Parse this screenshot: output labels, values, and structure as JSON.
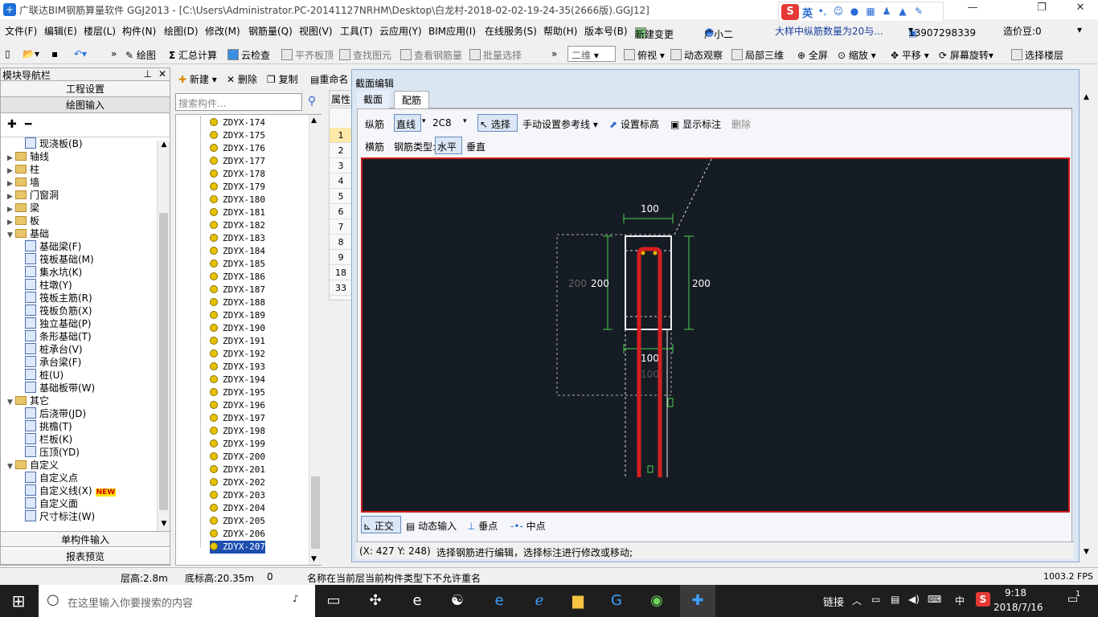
{
  "window": {
    "title": "广联达BIM钢筋算量软件 GGJ2013 - [C:\\Users\\Administrator.PC-20141127NRHM\\Desktop\\白龙村-2018-02-02-19-24-35(2666版).GGJ12]"
  },
  "ime": {
    "label": "英"
  },
  "menu": [
    "文件(F)",
    "编辑(E)",
    "楼层(L)",
    "构件(N)",
    "绘图(D)",
    "修改(M)",
    "钢筋量(Q)",
    "视图(V)",
    "工具(T)",
    "云应用(Y)",
    "BIM应用(I)",
    "在线服务(S)",
    "帮助(H)",
    "版本号(B)",
    "新建变更",
    "广小二"
  ],
  "menu_right": {
    "notice": "大样中纵筋数量为20与...",
    "phone": "13907298339",
    "price": "造价豆:0"
  },
  "toolbar": {
    "draw": "绘图",
    "sum": "汇总计算",
    "cloud_check": "云检查",
    "align_top": "平齐板顶",
    "find": "查找图元",
    "view_rebar": "查看钢筋量",
    "batch_select": "批量选择",
    "view_mode": "二维",
    "top_view": "俯视",
    "dynamic": "动态观察",
    "local3d": "局部三维",
    "fullscreen": "全屏",
    "zoom": "缩放",
    "pan": "平移",
    "rotate": "屏幕旋转",
    "select_floor": "选择楼层"
  },
  "nav": {
    "title": "模块导航栏",
    "project_settings": "工程设置",
    "drawing_input": "绘图输入",
    "single_input": "单构件输入",
    "report_preview": "报表预览",
    "tree": [
      {
        "label": "现浇板(B)",
        "type": "leaf",
        "indent": 2
      },
      {
        "label": "轴线",
        "type": "folder",
        "indent": 1
      },
      {
        "label": "柱",
        "type": "folder",
        "indent": 1
      },
      {
        "label": "墙",
        "type": "folder",
        "indent": 1
      },
      {
        "label": "门窗洞",
        "type": "folder",
        "indent": 1
      },
      {
        "label": "梁",
        "type": "folder",
        "indent": 1
      },
      {
        "label": "板",
        "type": "folder",
        "indent": 1
      },
      {
        "label": "基础",
        "type": "folder-open",
        "indent": 1
      },
      {
        "label": "基础梁(F)",
        "type": "leaf",
        "indent": 2
      },
      {
        "label": "筏板基础(M)",
        "type": "leaf",
        "indent": 2
      },
      {
        "label": "集水坑(K)",
        "type": "leaf",
        "indent": 2
      },
      {
        "label": "柱墩(Y)",
        "type": "leaf",
        "indent": 2
      },
      {
        "label": "筏板主筋(R)",
        "type": "leaf",
        "indent": 2
      },
      {
        "label": "筏板负筋(X)",
        "type": "leaf",
        "indent": 2
      },
      {
        "label": "独立基础(P)",
        "type": "leaf",
        "indent": 2
      },
      {
        "label": "条形基础(T)",
        "type": "leaf",
        "indent": 2
      },
      {
        "label": "桩承台(V)",
        "type": "leaf",
        "indent": 2
      },
      {
        "label": "承台梁(F)",
        "type": "leaf",
        "indent": 2
      },
      {
        "label": "桩(U)",
        "type": "leaf",
        "indent": 2
      },
      {
        "label": "基础板带(W)",
        "type": "leaf",
        "indent": 2
      },
      {
        "label": "其它",
        "type": "folder-open",
        "indent": 1
      },
      {
        "label": "后浇带(JD)",
        "type": "leaf",
        "indent": 2
      },
      {
        "label": "挑檐(T)",
        "type": "leaf",
        "indent": 2
      },
      {
        "label": "栏板(K)",
        "type": "leaf",
        "indent": 2
      },
      {
        "label": "压顶(YD)",
        "type": "leaf",
        "indent": 2
      },
      {
        "label": "自定义",
        "type": "folder-open",
        "indent": 1
      },
      {
        "label": "自定义点",
        "type": "leaf",
        "indent": 2
      },
      {
        "label": "自定义线(X)",
        "type": "leaf",
        "indent": 2,
        "badge": "NEW"
      },
      {
        "label": "自定义面",
        "type": "leaf",
        "indent": 2
      },
      {
        "label": "尺寸标注(W)",
        "type": "leaf",
        "indent": 2
      }
    ]
  },
  "list_toolbar": {
    "new": "新建",
    "delete": "删除",
    "copy": "复制",
    "rename": "重命名"
  },
  "search": {
    "placeholder": "搜索构件..."
  },
  "components": [
    "ZDYX-174",
    "ZDYX-175",
    "ZDYX-176",
    "ZDYX-177",
    "ZDYX-178",
    "ZDYX-179",
    "ZDYX-180",
    "ZDYX-181",
    "ZDYX-182",
    "ZDYX-183",
    "ZDYX-184",
    "ZDYX-185",
    "ZDYX-186",
    "ZDYX-187",
    "ZDYX-188",
    "ZDYX-189",
    "ZDYX-190",
    "ZDYX-191",
    "ZDYX-192",
    "ZDYX-193",
    "ZDYX-194",
    "ZDYX-195",
    "ZDYX-196",
    "ZDYX-197",
    "ZDYX-198",
    "ZDYX-199",
    "ZDYX-200",
    "ZDYX-201",
    "ZDYX-202",
    "ZDYX-203",
    "ZDYX-204",
    "ZDYX-205",
    "ZDYX-206",
    "ZDYX-207"
  ],
  "grid": {
    "tab": "属性",
    "rows": [
      "1",
      "2",
      "3",
      "4",
      "5",
      "6",
      "7",
      "8",
      "9",
      "18",
      "33"
    ]
  },
  "dialog": {
    "title": "截面编辑",
    "tabs": [
      "截面",
      "配筋"
    ],
    "row1": {
      "long_bar": "纵筋",
      "mode": "直线",
      "spec": "2C8",
      "select": "选择",
      "manual_ref": "手动设置参考线",
      "set_elev": "设置标高",
      "show_mark": "显示标注",
      "delete": "删除"
    },
    "row2": {
      "stirrup": "横筋",
      "type_label": "钢筋类型:",
      "horizontal": "水平",
      "vertical": "垂直"
    },
    "dims": {
      "top": "100",
      "left": "200",
      "left_ghost": "200",
      "right": "200",
      "bottom": "100",
      "bottom_ghost": "100"
    },
    "snap": {
      "ortho": "正交",
      "dyn_input": "动态输入",
      "perp": "垂点",
      "mid": "中点"
    },
    "status_coord": "(X: 427 Y: 248)",
    "status_msg": "选择钢筋进行编辑，选择标注进行修改或移动;"
  },
  "status": {
    "floor_h": "层高:2.8m",
    "base_elev": "底标高:20.35m",
    "zero": "0",
    "msg": "名称在当前层当前构件类型下不允许重名",
    "fps": "1003.2 FPS"
  },
  "taskbar": {
    "search": "在这里输入你要搜索的内容",
    "link": "链接",
    "lang": "中",
    "time": "9:18",
    "date": "2018/7/16",
    "notif": "1"
  }
}
